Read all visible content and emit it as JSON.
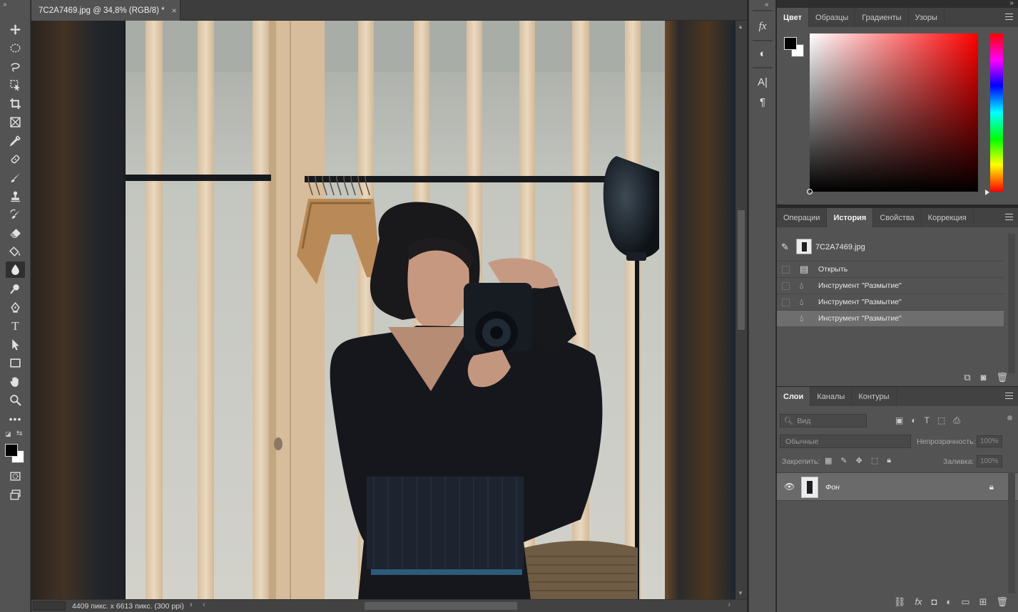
{
  "document": {
    "tab_title": "7C2A7469.jpg @ 34,8% (RGB/8) *",
    "status_info": "4409 пикс. x 6613 пикс. (300 ppi)"
  },
  "toolbar": {
    "tools": [
      "move-icon",
      "marquee-icon",
      "lasso-icon",
      "object-select-icon",
      "crop-icon",
      "frame-icon",
      "eyedropper-icon",
      "healing-icon",
      "brush-icon",
      "stamp-icon",
      "history-brush-icon",
      "eraser-icon",
      "bucket-icon",
      "blur-icon",
      "dodge-icon",
      "pen-icon",
      "type-icon",
      "path-select-icon",
      "rectangle-icon",
      "hand-icon",
      "zoom-icon",
      "more-tools-icon"
    ],
    "active_tool": "blur-icon",
    "type_tool_glyph": "T",
    "foreground_color": "#000000",
    "background_color": "#ffffff"
  },
  "color_panel": {
    "tabs": [
      "Цвет",
      "Образцы",
      "Градиенты",
      "Узоры"
    ],
    "active_tab": "Цвет",
    "hue_color": "#ff0000"
  },
  "history_panel": {
    "tabs": [
      "Операции",
      "История",
      "Свойства",
      "Коррекция"
    ],
    "active_tab": "История",
    "snapshot": "7C2A7469.jpg",
    "items": [
      {
        "icon": "document-icon",
        "label": "Открыть"
      },
      {
        "icon": "blur-icon",
        "label": "Инструмент \"Размытие\""
      },
      {
        "icon": "blur-icon",
        "label": "Инструмент \"Размытие\""
      },
      {
        "icon": "blur-icon",
        "label": "Инструмент \"Размытие\""
      }
    ],
    "selected_index": 3
  },
  "layers_panel": {
    "tabs": [
      "Слои",
      "Каналы",
      "Контуры"
    ],
    "active_tab": "Слои",
    "filter_placeholder": "Вид",
    "blend_mode": "Обычные",
    "opacity_label": "Непрозрачность:",
    "opacity_value": "100%",
    "lock_label": "Закрепить:",
    "fill_label": "Заливка:",
    "fill_value": "100%",
    "layers": [
      {
        "name": "Фон",
        "visible": true,
        "locked": true
      }
    ]
  }
}
